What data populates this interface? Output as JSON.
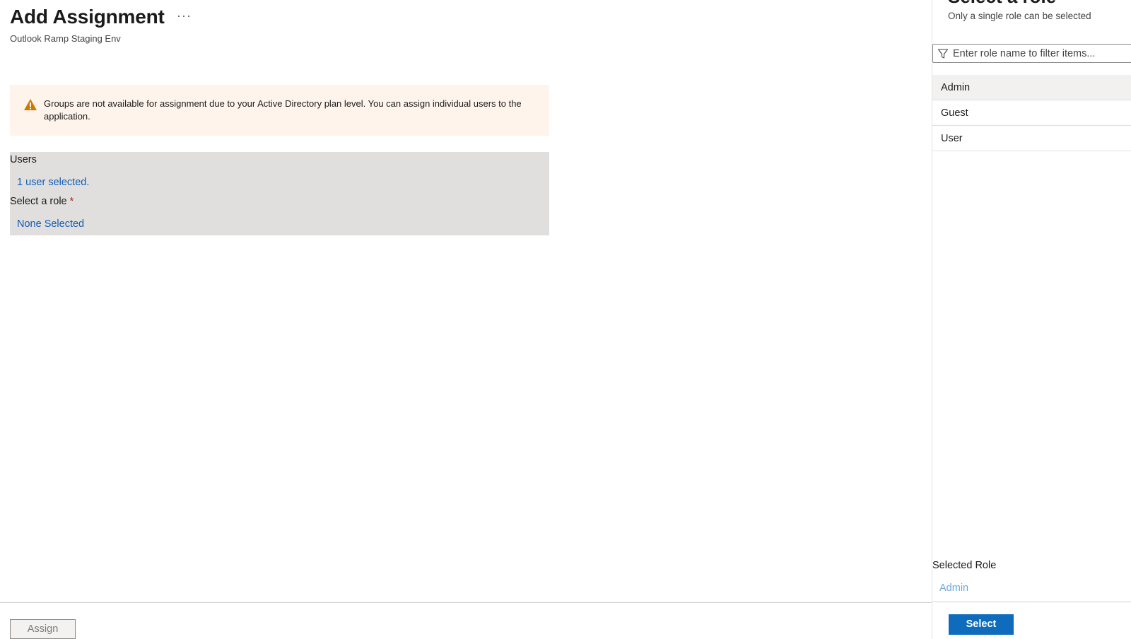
{
  "page": {
    "title": "Add Assignment",
    "more_label": "···",
    "subtitle": "Outlook Ramp Staging Env"
  },
  "warning": {
    "icon": "warning-triangle-icon",
    "text": "Groups are not available for assignment due to your Active Directory plan level. You can assign individual users to the application."
  },
  "form": {
    "users_label": "Users",
    "users_value": "1 user selected.",
    "role_label": "Select a role",
    "required_marker": "*",
    "role_value": "None Selected"
  },
  "footer": {
    "assign_label": "Assign"
  },
  "side_panel": {
    "title": "Select a role",
    "subtitle": "Only a single role can be selected",
    "filter": {
      "icon": "filter-icon",
      "placeholder": "Enter role name to filter items...",
      "value": ""
    },
    "roles": [
      {
        "label": "Admin",
        "selected": true
      },
      {
        "label": "Guest",
        "selected": false
      },
      {
        "label": "User",
        "selected": false
      }
    ],
    "selected_role_label": "Selected Role",
    "selected_role_value": "Admin",
    "select_button_label": "Select"
  },
  "colors": {
    "accent": "#0f6cbd",
    "link": "#0f5cb8",
    "warning_bg": "#fff4ec",
    "warning_icon": "#d47500",
    "form_bg": "#e1dfdd"
  }
}
